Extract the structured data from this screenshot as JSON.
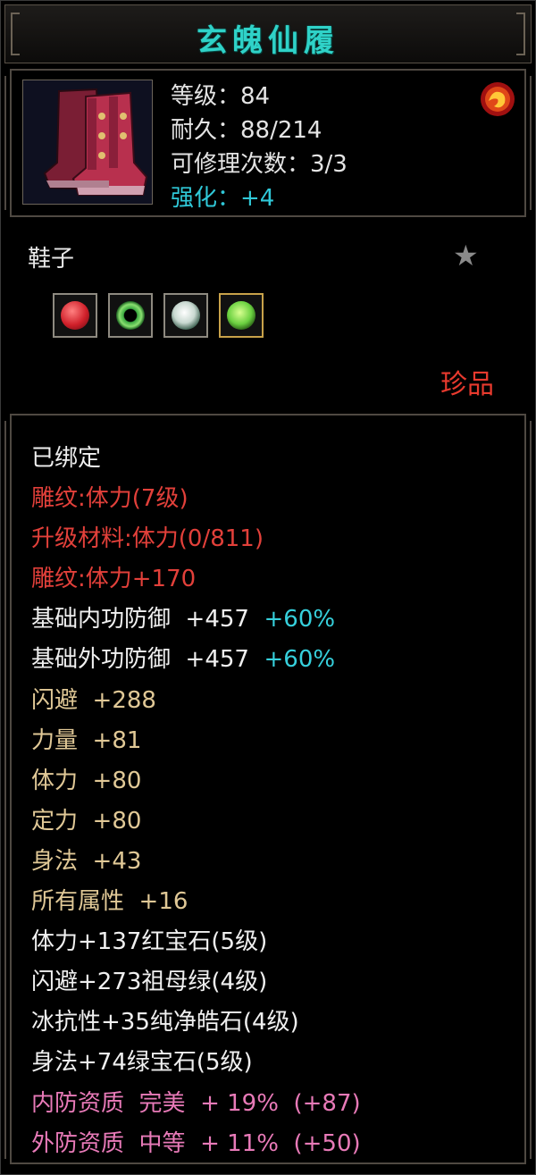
{
  "title": "玄魄仙履",
  "header": {
    "level": "等级：84",
    "durability": "耐久：88/214",
    "repairs": "可修理次数：3/3",
    "enhance": "强化：+4"
  },
  "item_type": "鞋子",
  "rarity": "珍品",
  "gems": [
    {
      "icon": "ruby-gem-icon",
      "color": "#d0202a"
    },
    {
      "icon": "jade-ring-gem-icon",
      "color": "#3aa840"
    },
    {
      "icon": "diamond-gem-icon",
      "color": "#c8d8d0"
    },
    {
      "icon": "green-gem-icon",
      "color": "#6ad040"
    }
  ],
  "attributes": {
    "bound": "已绑定",
    "engrave_level": "雕纹:体力(7级)",
    "upgrade_material": "升级材料:体力(0/811)",
    "engrave_bonus": "雕纹:体力+170",
    "inner_defense": {
      "label": "基础内功防御",
      "value": "+457",
      "bonus": "+60%"
    },
    "outer_defense": {
      "label": "基础外功防御",
      "value": "+457",
      "bonus": "+60%"
    },
    "stats": [
      {
        "label": "闪避",
        "value": "+288"
      },
      {
        "label": "力量",
        "value": "+81"
      },
      {
        "label": "体力",
        "value": "+80"
      },
      {
        "label": "定力",
        "value": "+80"
      },
      {
        "label": "身法",
        "value": "+43"
      },
      {
        "label": "所有属性",
        "value": "+16"
      }
    ],
    "gem_stats": [
      "体力+137红宝石(5级)",
      "闪避+273祖母绿(4级)",
      "冰抗性+35纯净皓石(4级)",
      "身法+74绿宝石(5级)"
    ],
    "inner_quality": {
      "label": "内防资质",
      "grade": "完美",
      "value": "+ 19%",
      "extra": "(+87)"
    },
    "outer_quality": {
      "label": "外防资质",
      "grade": "中等",
      "value": "+ 11%",
      "extra": "(+50)"
    }
  },
  "colors": {
    "title": "#2fd2c8",
    "enhance": "#30c8d8",
    "red": "#e2403a",
    "yellow": "#e0c896",
    "pink": "#e87ab8",
    "rarity": "#e83a2e"
  }
}
